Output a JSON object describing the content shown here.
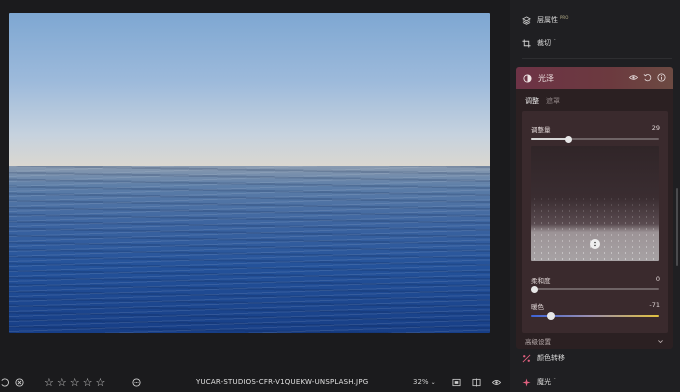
{
  "bottom_bar": {
    "stars": [
      "☆",
      "☆",
      "☆",
      "☆",
      "☆"
    ],
    "filename": "YUCAR-STUDIOS-CFR-V1QUEKW-UNSPLASH.JPG",
    "zoom": "32%",
    "zoom_caret": "⌄"
  },
  "panel": {
    "layers": {
      "label": "层属性",
      "badge": "PRO"
    },
    "crop": {
      "label": "裁切",
      "badge": "⌃"
    },
    "gloss": {
      "title": "光泽",
      "tabs": [
        "调整",
        "遮罩"
      ],
      "amount": {
        "label": "调整量",
        "value": "29",
        "fraction": 0.29
      },
      "softness": {
        "label": "柔和度",
        "value": "0",
        "fraction": 0
      },
      "warmth": {
        "label": "暖色",
        "value": "-71",
        "fraction": 0.155
      },
      "advanced": "高级设置"
    },
    "color_shift": {
      "label": "颜色转移"
    },
    "magic_light": {
      "label": "魔光",
      "badge": "⌃"
    }
  },
  "colors": {
    "gloss_header": "#6d3346",
    "warm_gradient_start": "#3d63d8",
    "warm_gradient_end": "#e2c23f",
    "accent_pink": "#e0607f"
  }
}
